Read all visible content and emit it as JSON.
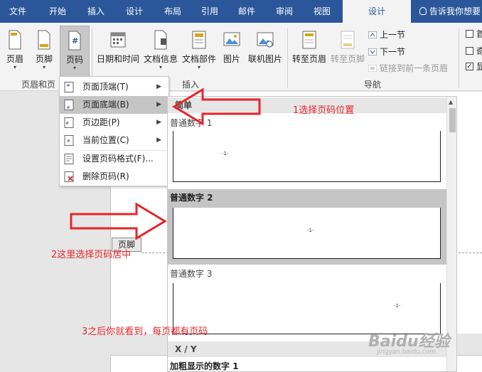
{
  "tabs": [
    {
      "label": "文件"
    },
    {
      "label": "开始"
    },
    {
      "label": "插入"
    },
    {
      "label": "设计"
    },
    {
      "label": "布局"
    },
    {
      "label": "引用"
    },
    {
      "label": "邮件"
    },
    {
      "label": "审阅"
    },
    {
      "label": "视图"
    },
    {
      "label": "设计"
    }
  ],
  "tell_me": "告诉我你想要",
  "ribbon": {
    "header_label": "页眉",
    "footer_label": "页脚",
    "page_number_label": "页码",
    "header_footer_group": "页眉和页",
    "date_time_label": "日期和时间",
    "doc_info_label": "文档信息",
    "doc_parts_label": "文档部件",
    "picture_label": "图片",
    "online_picture_label": "联机图片",
    "insert_group": "插入",
    "go_to_header_label": "转至页眉",
    "go_to_footer_label": "转至页脚",
    "previous_label": "上一节",
    "next_label": "下一节",
    "link_previous_label": "链接到前一条页眉",
    "navigation_group": "导航",
    "option_1": "首",
    "option_2": "奇",
    "option_3": "显"
  },
  "menu": {
    "items": [
      {
        "label": "页面顶端(T)"
      },
      {
        "label": "页面底端(B)"
      },
      {
        "label": "页边距(P)"
      },
      {
        "label": "当前位置(C)"
      },
      {
        "label": "设置页码格式(F)..."
      },
      {
        "label": "删除页码(R)"
      }
    ]
  },
  "gallery": {
    "section_simple": "简单",
    "item_1": "普通数字 1",
    "item_2": "普通数字 2",
    "item_3": "普通数字 3",
    "page_number_sample": "-1-",
    "section_xy": "X / Y",
    "item_bold": "加粗显示的数字 1"
  },
  "document": {
    "footer_tag": "页脚"
  },
  "annotations": {
    "step1": "1选择页码位置",
    "step2": "2这里选择页码居中",
    "step3": "3之后你就看到，每页都有页码"
  },
  "watermark": {
    "brand": "Baidu经验",
    "url": "jingyan.baidu.com"
  },
  "colors": {
    "accent": "#2b579a",
    "annotation": "#e8242a"
  }
}
